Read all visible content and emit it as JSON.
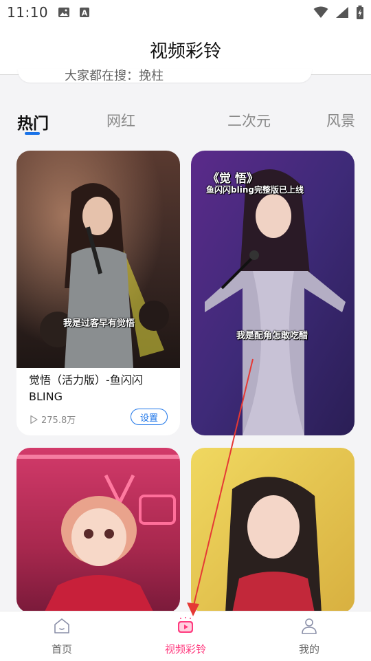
{
  "status_bar": {
    "time": "11:10"
  },
  "app_bar": {
    "title": "视频彩铃"
  },
  "search": {
    "hint_text": "大家都在搜：挽柱"
  },
  "tabs": [
    {
      "label": "热门",
      "active": true
    },
    {
      "label": "网红",
      "active": false
    },
    {
      "label": "二次元",
      "active": false
    },
    {
      "label": "风景",
      "active": false
    }
  ],
  "cards": [
    {
      "title": "觉悟（活力版）-鱼闪闪BLING",
      "plays": "275.8万",
      "set_label": "设置",
      "captions": [
        "我是过客早有觉悟"
      ]
    },
    {
      "captions": [
        "《觉 悟》",
        "鱼闪闪bling完整版已上线",
        "我是配角怎敢吃醋"
      ]
    },
    {
      "captions": []
    },
    {
      "captions": []
    }
  ],
  "bottom_nav": [
    {
      "label": "首页",
      "icon": "home-icon",
      "active": false
    },
    {
      "label": "视频彩铃",
      "icon": "video-play-icon",
      "active": true
    },
    {
      "label": "我的",
      "icon": "user-icon",
      "active": false
    }
  ],
  "colors": {
    "accent_blue": "#1a73e8",
    "accent_pink": "#ff3b7f",
    "annotation_red": "#e53935"
  }
}
